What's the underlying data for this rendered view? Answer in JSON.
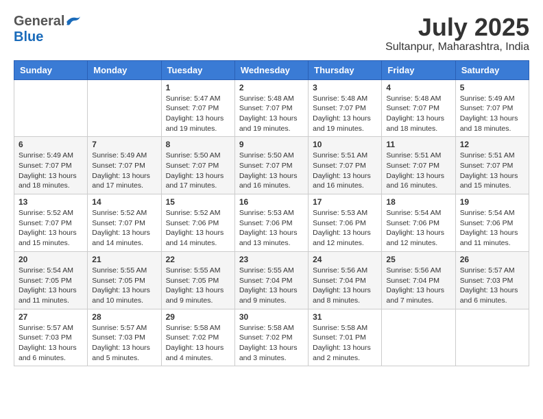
{
  "header": {
    "logo_general": "General",
    "logo_blue": "Blue",
    "month_title": "July 2025",
    "location": "Sultanpur, Maharashtra, India"
  },
  "days_of_week": [
    "Sunday",
    "Monday",
    "Tuesday",
    "Wednesday",
    "Thursday",
    "Friday",
    "Saturday"
  ],
  "weeks": [
    [
      {
        "day": "",
        "info": ""
      },
      {
        "day": "",
        "info": ""
      },
      {
        "day": "1",
        "info": "Sunrise: 5:47 AM\nSunset: 7:07 PM\nDaylight: 13 hours\nand 19 minutes."
      },
      {
        "day": "2",
        "info": "Sunrise: 5:48 AM\nSunset: 7:07 PM\nDaylight: 13 hours\nand 19 minutes."
      },
      {
        "day": "3",
        "info": "Sunrise: 5:48 AM\nSunset: 7:07 PM\nDaylight: 13 hours\nand 19 minutes."
      },
      {
        "day": "4",
        "info": "Sunrise: 5:48 AM\nSunset: 7:07 PM\nDaylight: 13 hours\nand 18 minutes."
      },
      {
        "day": "5",
        "info": "Sunrise: 5:49 AM\nSunset: 7:07 PM\nDaylight: 13 hours\nand 18 minutes."
      }
    ],
    [
      {
        "day": "6",
        "info": "Sunrise: 5:49 AM\nSunset: 7:07 PM\nDaylight: 13 hours\nand 18 minutes."
      },
      {
        "day": "7",
        "info": "Sunrise: 5:49 AM\nSunset: 7:07 PM\nDaylight: 13 hours\nand 17 minutes."
      },
      {
        "day": "8",
        "info": "Sunrise: 5:50 AM\nSunset: 7:07 PM\nDaylight: 13 hours\nand 17 minutes."
      },
      {
        "day": "9",
        "info": "Sunrise: 5:50 AM\nSunset: 7:07 PM\nDaylight: 13 hours\nand 16 minutes."
      },
      {
        "day": "10",
        "info": "Sunrise: 5:51 AM\nSunset: 7:07 PM\nDaylight: 13 hours\nand 16 minutes."
      },
      {
        "day": "11",
        "info": "Sunrise: 5:51 AM\nSunset: 7:07 PM\nDaylight: 13 hours\nand 16 minutes."
      },
      {
        "day": "12",
        "info": "Sunrise: 5:51 AM\nSunset: 7:07 PM\nDaylight: 13 hours\nand 15 minutes."
      }
    ],
    [
      {
        "day": "13",
        "info": "Sunrise: 5:52 AM\nSunset: 7:07 PM\nDaylight: 13 hours\nand 15 minutes."
      },
      {
        "day": "14",
        "info": "Sunrise: 5:52 AM\nSunset: 7:07 PM\nDaylight: 13 hours\nand 14 minutes."
      },
      {
        "day": "15",
        "info": "Sunrise: 5:52 AM\nSunset: 7:06 PM\nDaylight: 13 hours\nand 14 minutes."
      },
      {
        "day": "16",
        "info": "Sunrise: 5:53 AM\nSunset: 7:06 PM\nDaylight: 13 hours\nand 13 minutes."
      },
      {
        "day": "17",
        "info": "Sunrise: 5:53 AM\nSunset: 7:06 PM\nDaylight: 13 hours\nand 12 minutes."
      },
      {
        "day": "18",
        "info": "Sunrise: 5:54 AM\nSunset: 7:06 PM\nDaylight: 13 hours\nand 12 minutes."
      },
      {
        "day": "19",
        "info": "Sunrise: 5:54 AM\nSunset: 7:06 PM\nDaylight: 13 hours\nand 11 minutes."
      }
    ],
    [
      {
        "day": "20",
        "info": "Sunrise: 5:54 AM\nSunset: 7:05 PM\nDaylight: 13 hours\nand 11 minutes."
      },
      {
        "day": "21",
        "info": "Sunrise: 5:55 AM\nSunset: 7:05 PM\nDaylight: 13 hours\nand 10 minutes."
      },
      {
        "day": "22",
        "info": "Sunrise: 5:55 AM\nSunset: 7:05 PM\nDaylight: 13 hours\nand 9 minutes."
      },
      {
        "day": "23",
        "info": "Sunrise: 5:55 AM\nSunset: 7:04 PM\nDaylight: 13 hours\nand 9 minutes."
      },
      {
        "day": "24",
        "info": "Sunrise: 5:56 AM\nSunset: 7:04 PM\nDaylight: 13 hours\nand 8 minutes."
      },
      {
        "day": "25",
        "info": "Sunrise: 5:56 AM\nSunset: 7:04 PM\nDaylight: 13 hours\nand 7 minutes."
      },
      {
        "day": "26",
        "info": "Sunrise: 5:57 AM\nSunset: 7:03 PM\nDaylight: 13 hours\nand 6 minutes."
      }
    ],
    [
      {
        "day": "27",
        "info": "Sunrise: 5:57 AM\nSunset: 7:03 PM\nDaylight: 13 hours\nand 6 minutes."
      },
      {
        "day": "28",
        "info": "Sunrise: 5:57 AM\nSunset: 7:03 PM\nDaylight: 13 hours\nand 5 minutes."
      },
      {
        "day": "29",
        "info": "Sunrise: 5:58 AM\nSunset: 7:02 PM\nDaylight: 13 hours\nand 4 minutes."
      },
      {
        "day": "30",
        "info": "Sunrise: 5:58 AM\nSunset: 7:02 PM\nDaylight: 13 hours\nand 3 minutes."
      },
      {
        "day": "31",
        "info": "Sunrise: 5:58 AM\nSunset: 7:01 PM\nDaylight: 13 hours\nand 2 minutes."
      },
      {
        "day": "",
        "info": ""
      },
      {
        "day": "",
        "info": ""
      }
    ]
  ]
}
